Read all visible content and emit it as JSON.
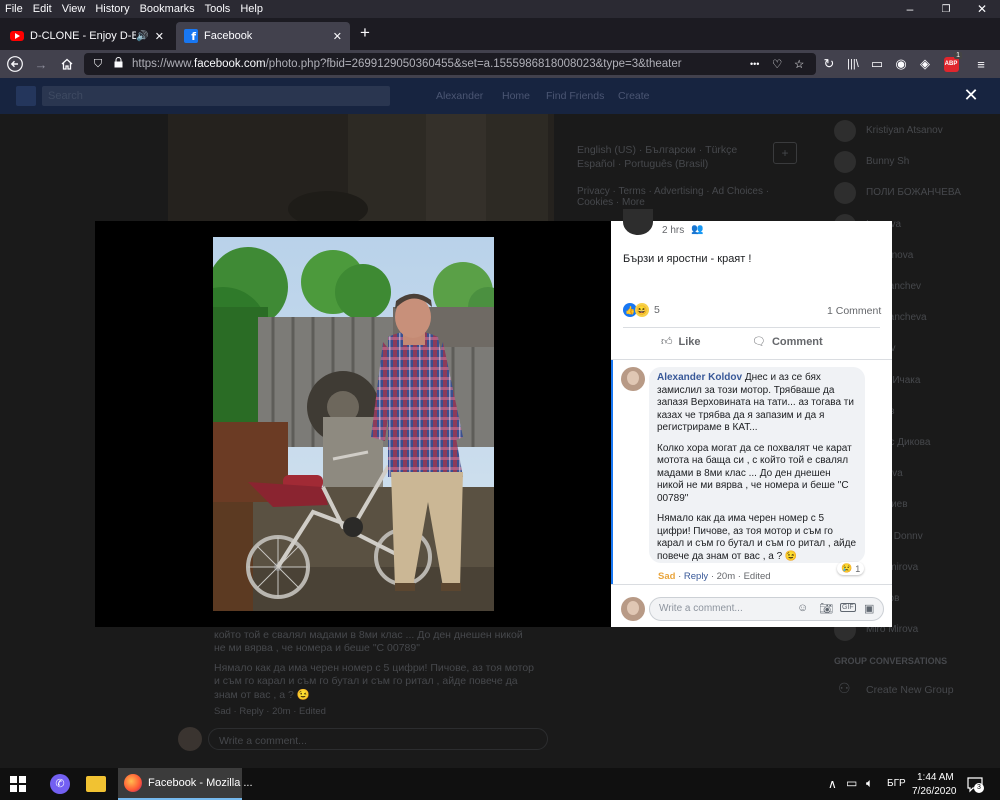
{
  "menubar": {
    "items": [
      "File",
      "Edit",
      "View",
      "History",
      "Bookmarks",
      "Tools",
      "Help"
    ],
    "window_controls": {
      "minimize": "–",
      "restore": "❐",
      "close": "✕"
    }
  },
  "tabs": [
    {
      "title": "D-CLONE - Enjoy D-Beat & Ro",
      "icon": "youtube-icon",
      "audio": "🔊"
    },
    {
      "title": "Facebook",
      "icon": "facebook-icon",
      "active": true
    }
  ],
  "toolbar": {
    "url_prefix": "https://www.",
    "url_host": "facebook.com",
    "url_rest": "/photo.php?fbid=2699129050360455&set=a.1555986818008023&type=3&theater",
    "ellipsis": "•••",
    "abp_badge": "1"
  },
  "background": {
    "nav_user": "Alexander",
    "nav_home": "Home",
    "nav_find_friends": "Find Friends",
    "nav_create": "Create",
    "search_placeholder": "Search",
    "languages_line1": "English (US) · Български · Türkçe",
    "languages_line2": "Español · Português (Brasil)",
    "footer_links": "Privacy · Terms · Advertising · Ad Choices · Cookies · More",
    "contacts": [
      "Kristiyan Atsanov",
      "Bunny Sh",
      "ПОЛИ БОЖАНЧЕВА",
      "Ivanova",
      "Stoyanova",
      "Bozhanchev",
      "Bozhancheva",
      "Ivanov",
      "Ивай Ичака",
      "Ходов",
      "Денис Дикова",
      "Chuleva",
      "Георгиев",
      "Bojos Donnv",
      "Vladimirova",
      "Петров",
      "Miro Mirova"
    ],
    "group_conversations": "GROUP CONVERSATIONS",
    "create_new_group": "Create New Group",
    "dim_comment_1": "който той е свалял мадами в 8ми клас ... До ден днешен никой",
    "dim_comment_2": "не ми вярва , че номера и беше \"С 00789\"",
    "dim_comment_3": "Нямало как да има черен номер с 5 цифри! Пичове, аз тоя мотор",
    "dim_comment_4": "и съм го карал и съм го бутал и съм го ритал , айде повече да",
    "dim_comment_5": "знам от вас , а ? 😉",
    "dim_actions": "Sad · Reply · 20m · Edited",
    "dim_write": "Write a comment..."
  },
  "close_icon_label": "✕",
  "post": {
    "time": "2 hrs",
    "caption": "Бързи и яростни - краят !",
    "reaction_count": "5",
    "comment_count": "1 Comment",
    "like_label": "Like",
    "comment_label": "Comment"
  },
  "comment": {
    "author": "Alexander Koldov",
    "para1": "Днес и аз се бях замислил за този мотор. Трябваше да запазя Верховината на тати... аз тогава ти казах че трябва да я запазим и да я регистрираме в КАТ...",
    "para2": "Колко хора могат да се похвалят че карат мотота на баща си , с който той е свалял мадами в 8ми клас ... До ден днешен никой не ми вярва , че номера и беше \"С 00789\"",
    "para3": "Нямало как да има черен номер с 5 цифри! Пичове, аз тоя мотор и съм го карал и съм го бутал и съм го ритал , айде повече да знам от вас , а ? 😉",
    "reaction_emoji": "😢",
    "reaction_count": "1",
    "sad_label": "Sad",
    "reply_label": "Reply",
    "time": "20m",
    "edited_label": "Edited"
  },
  "write_comment_placeholder": "Write a comment...",
  "taskbar": {
    "firefox_label": "Facebook - Mozilla ...",
    "language": "БГР",
    "time": "1:44 AM",
    "date": "7/26/2020",
    "notification_count": "3"
  },
  "colors": {
    "facebook_blue": "#1877f2",
    "link_blue": "#385898",
    "sad_yellow": "#e9a53d"
  }
}
